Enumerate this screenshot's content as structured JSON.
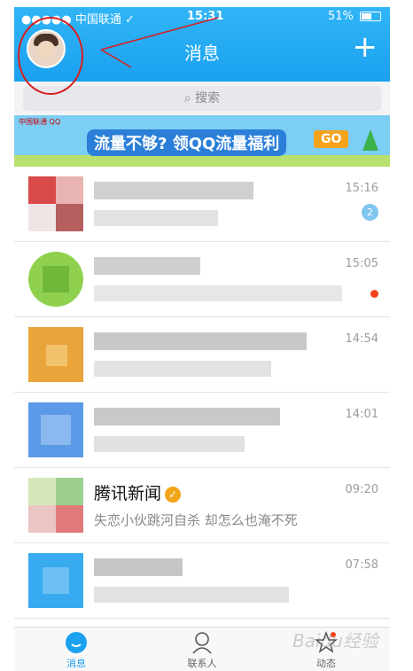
{
  "status_bar": {
    "carrier": "●●●●● 中国联通 ✓",
    "time": "15:31",
    "battery_text": "51%"
  },
  "header": {
    "title": "消息",
    "plus_label": "+"
  },
  "search": {
    "placeholder": "搜索"
  },
  "banner": {
    "logo_text": "中国联通 QQ",
    "headline": "流量不够? 领QQ流量福利",
    "go_label": "GO"
  },
  "conversations": [
    {
      "time": "15:16",
      "badge": "2",
      "name": "",
      "message": ""
    },
    {
      "time": "15:05",
      "name": "",
      "message": ""
    },
    {
      "time": "14:54",
      "name": "",
      "message": ""
    },
    {
      "time": "14:01",
      "name": "",
      "message": ""
    },
    {
      "time": "09:20",
      "name": "腾讯新闻",
      "message": "失恋小伙跳河自杀 却怎么也淹不死"
    },
    {
      "time": "07:58",
      "name": "",
      "message": ""
    }
  ],
  "tabs": [
    {
      "label": "消息"
    },
    {
      "label": "联系人"
    },
    {
      "label": "动态"
    }
  ],
  "watermark": "Baidu经验",
  "colors": {
    "brand": "#1aa1ef",
    "annotation": "#d81e1e"
  }
}
